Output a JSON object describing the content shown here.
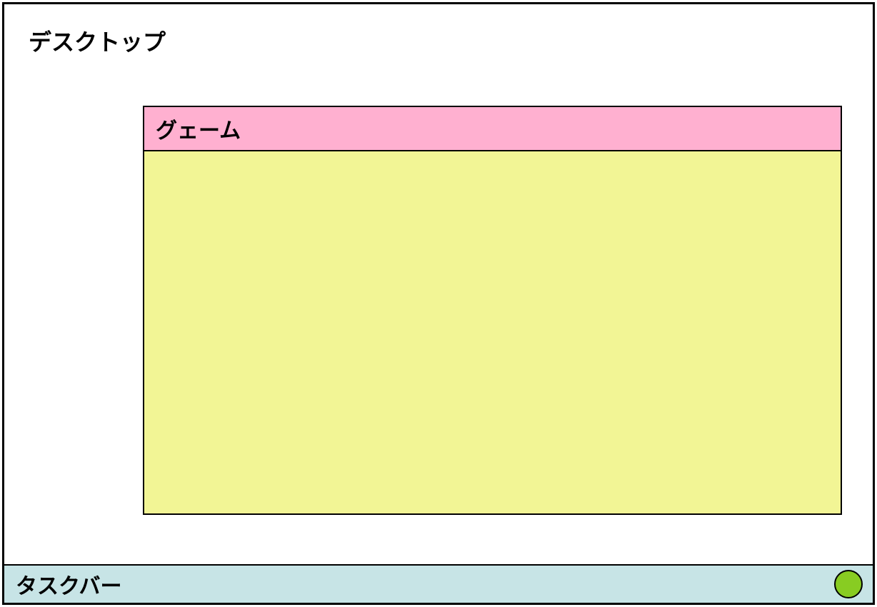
{
  "desktop": {
    "label": "デスクトップ"
  },
  "window": {
    "title": "グェーム"
  },
  "taskbar": {
    "label": "タスクバー",
    "status_color": "#88cc22"
  }
}
